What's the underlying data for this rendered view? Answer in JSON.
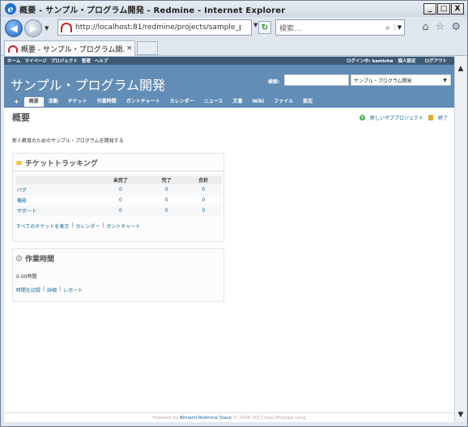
{
  "window": {
    "title": "概要 - サンプル・プログラム開発 - Redmine - Internet Explorer",
    "controls": [
      "_",
      "□",
      "X"
    ]
  },
  "browser": {
    "address_url": "http://localhost:81/redmine/projects/sample_pro",
    "search_placeholder": "検索...",
    "tab_label": "概要 - サンプル・プログラム開...",
    "tab_close": "×",
    "icons": [
      "back-icon",
      "forward-icon",
      "home-icon",
      "star-icon",
      "gear-icon"
    ]
  },
  "top_menu": {
    "left": [
      "ホーム",
      "マイページ",
      "プロジェクト",
      "管理",
      "ヘルプ"
    ],
    "login_label": "ログイン中: kamisha",
    "personal_settings": "個人設定",
    "logout": "ログアウト"
  },
  "header": {
    "project_title": "サンプル・プログラム開発",
    "search_label": "検索:",
    "project_select": "サンプル・プログラム開発"
  },
  "main_menu": {
    "plus": "+",
    "items": [
      "概要",
      "活動",
      "チケット",
      "作業時間",
      "ガントチャート",
      "カレンダー",
      "ニュース",
      "文書",
      "Wiki",
      "ファイル",
      "設定"
    ]
  },
  "content": {
    "page_title": "概要",
    "new_subproject": "新しいサブプロジェクト",
    "close": "終了",
    "description": "新人教育のためのサンプル・プログラムを開発する"
  },
  "issue_tracking": {
    "heading": "チケットトラッキング",
    "columns": [
      "",
      "未完了",
      "完了",
      "合計"
    ],
    "rows": [
      {
        "name": "バグ",
        "open": "0",
        "closed": "0",
        "total": "0"
      },
      {
        "name": "機能",
        "open": "0",
        "closed": "0",
        "total": "0"
      },
      {
        "name": "サポート",
        "open": "0",
        "closed": "0",
        "total": "0"
      }
    ],
    "links": [
      "すべてのチケットを表示",
      "カレンダー",
      "ガントチャート"
    ]
  },
  "spent_time": {
    "heading": "作業時間",
    "value": "0.00時間",
    "links": [
      "時間を記録",
      "詳細",
      "レポート"
    ]
  },
  "footer": {
    "prefix": "Powered by",
    "link": "Bitnami Redmine Stack",
    "suffix": "© 2006-2017 Jean-Philippe Lang"
  }
}
